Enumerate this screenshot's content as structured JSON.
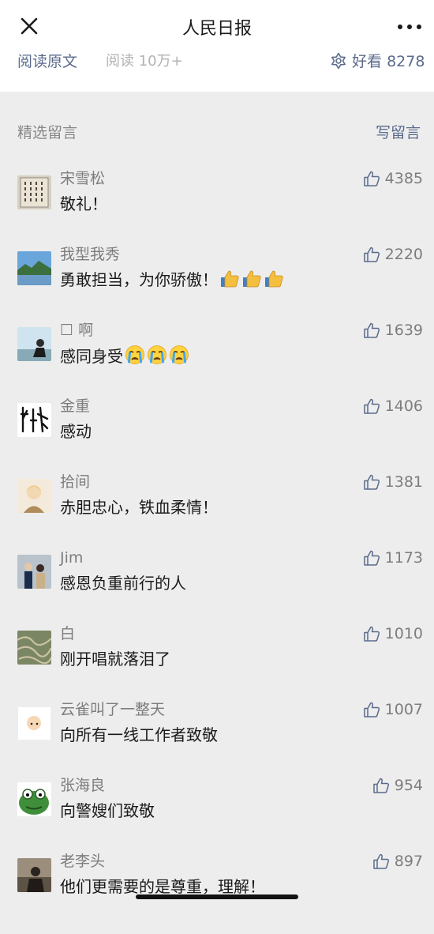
{
  "header": {
    "title": "人民日报",
    "close_icon": "close-icon",
    "more_icon": "more-icon"
  },
  "stats": {
    "read_original": "阅读原文",
    "read_count": "阅读 10万+",
    "like_prefix": "好看",
    "like_count": "8278"
  },
  "comments_section": {
    "label": "精选留言",
    "write": "写留言"
  },
  "comments": [
    {
      "name": "宋雪松",
      "text": "敬礼！",
      "likes": "4385",
      "emoji": "",
      "emoji_count": 0
    },
    {
      "name": "我型我秀",
      "text": "勇敢担当，为你骄傲！",
      "likes": "2220",
      "emoji": "thumbs-up-emoji",
      "emoji_count": 3
    },
    {
      "name": "☐ 啊",
      "text": "感同身受",
      "likes": "1639",
      "emoji": "crying-emoji",
      "emoji_count": 3
    },
    {
      "name": "金重",
      "text": "感动",
      "likes": "1406",
      "emoji": "",
      "emoji_count": 0
    },
    {
      "name": "拾间",
      "text": "赤胆忠心，铁血柔情！",
      "likes": "1381",
      "emoji": "",
      "emoji_count": 0
    },
    {
      "name": "Jim",
      "text": "感恩负重前行的人",
      "likes": "1173",
      "emoji": "",
      "emoji_count": 0
    },
    {
      "name": "白",
      "text": "刚开唱就落泪了",
      "likes": "1010",
      "emoji": "",
      "emoji_count": 0
    },
    {
      "name": "云雀叫了一整天",
      "text": "向所有一线工作者致敬",
      "likes": "1007",
      "emoji": "",
      "emoji_count": 0
    },
    {
      "name": "张海良",
      "text": "向警嫂们致敬",
      "likes": "954",
      "emoji": "",
      "emoji_count": 0
    },
    {
      "name": "老李头",
      "text": "他们更需要的是尊重，理解！",
      "likes": "897",
      "emoji": "",
      "emoji_count": 0
    }
  ],
  "colors": {
    "link": "#5b6b8c",
    "muted": "#7d7d7d",
    "background": "#ededed"
  }
}
